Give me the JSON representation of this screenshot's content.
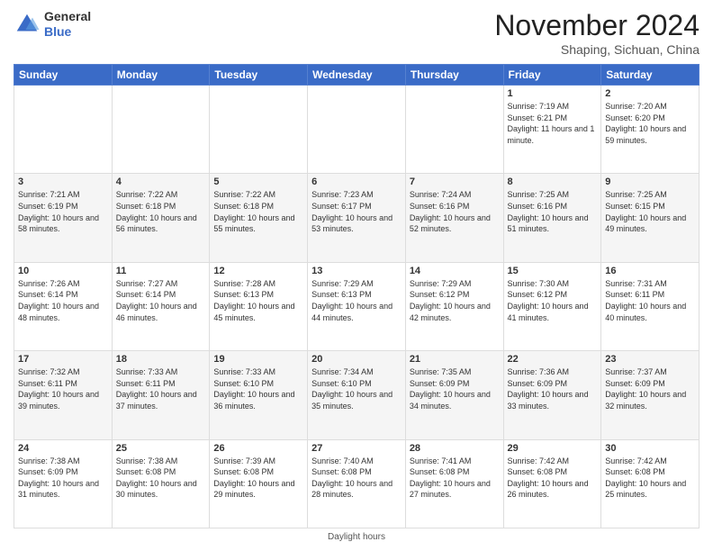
{
  "logo": {
    "line1": "General",
    "line2": "Blue"
  },
  "title": "November 2024",
  "location": "Shaping, Sichuan, China",
  "days_of_week": [
    "Sunday",
    "Monday",
    "Tuesday",
    "Wednesday",
    "Thursday",
    "Friday",
    "Saturday"
  ],
  "footer": "Daylight hours",
  "weeks": [
    [
      {
        "day": "",
        "info": ""
      },
      {
        "day": "",
        "info": ""
      },
      {
        "day": "",
        "info": ""
      },
      {
        "day": "",
        "info": ""
      },
      {
        "day": "",
        "info": ""
      },
      {
        "day": "1",
        "info": "Sunrise: 7:19 AM\nSunset: 6:21 PM\nDaylight: 11 hours and 1 minute."
      },
      {
        "day": "2",
        "info": "Sunrise: 7:20 AM\nSunset: 6:20 PM\nDaylight: 10 hours and 59 minutes."
      }
    ],
    [
      {
        "day": "3",
        "info": "Sunrise: 7:21 AM\nSunset: 6:19 PM\nDaylight: 10 hours and 58 minutes."
      },
      {
        "day": "4",
        "info": "Sunrise: 7:22 AM\nSunset: 6:18 PM\nDaylight: 10 hours and 56 minutes."
      },
      {
        "day": "5",
        "info": "Sunrise: 7:22 AM\nSunset: 6:18 PM\nDaylight: 10 hours and 55 minutes."
      },
      {
        "day": "6",
        "info": "Sunrise: 7:23 AM\nSunset: 6:17 PM\nDaylight: 10 hours and 53 minutes."
      },
      {
        "day": "7",
        "info": "Sunrise: 7:24 AM\nSunset: 6:16 PM\nDaylight: 10 hours and 52 minutes."
      },
      {
        "day": "8",
        "info": "Sunrise: 7:25 AM\nSunset: 6:16 PM\nDaylight: 10 hours and 51 minutes."
      },
      {
        "day": "9",
        "info": "Sunrise: 7:25 AM\nSunset: 6:15 PM\nDaylight: 10 hours and 49 minutes."
      }
    ],
    [
      {
        "day": "10",
        "info": "Sunrise: 7:26 AM\nSunset: 6:14 PM\nDaylight: 10 hours and 48 minutes."
      },
      {
        "day": "11",
        "info": "Sunrise: 7:27 AM\nSunset: 6:14 PM\nDaylight: 10 hours and 46 minutes."
      },
      {
        "day": "12",
        "info": "Sunrise: 7:28 AM\nSunset: 6:13 PM\nDaylight: 10 hours and 45 minutes."
      },
      {
        "day": "13",
        "info": "Sunrise: 7:29 AM\nSunset: 6:13 PM\nDaylight: 10 hours and 44 minutes."
      },
      {
        "day": "14",
        "info": "Sunrise: 7:29 AM\nSunset: 6:12 PM\nDaylight: 10 hours and 42 minutes."
      },
      {
        "day": "15",
        "info": "Sunrise: 7:30 AM\nSunset: 6:12 PM\nDaylight: 10 hours and 41 minutes."
      },
      {
        "day": "16",
        "info": "Sunrise: 7:31 AM\nSunset: 6:11 PM\nDaylight: 10 hours and 40 minutes."
      }
    ],
    [
      {
        "day": "17",
        "info": "Sunrise: 7:32 AM\nSunset: 6:11 PM\nDaylight: 10 hours and 39 minutes."
      },
      {
        "day": "18",
        "info": "Sunrise: 7:33 AM\nSunset: 6:11 PM\nDaylight: 10 hours and 37 minutes."
      },
      {
        "day": "19",
        "info": "Sunrise: 7:33 AM\nSunset: 6:10 PM\nDaylight: 10 hours and 36 minutes."
      },
      {
        "day": "20",
        "info": "Sunrise: 7:34 AM\nSunset: 6:10 PM\nDaylight: 10 hours and 35 minutes."
      },
      {
        "day": "21",
        "info": "Sunrise: 7:35 AM\nSunset: 6:09 PM\nDaylight: 10 hours and 34 minutes."
      },
      {
        "day": "22",
        "info": "Sunrise: 7:36 AM\nSunset: 6:09 PM\nDaylight: 10 hours and 33 minutes."
      },
      {
        "day": "23",
        "info": "Sunrise: 7:37 AM\nSunset: 6:09 PM\nDaylight: 10 hours and 32 minutes."
      }
    ],
    [
      {
        "day": "24",
        "info": "Sunrise: 7:38 AM\nSunset: 6:09 PM\nDaylight: 10 hours and 31 minutes."
      },
      {
        "day": "25",
        "info": "Sunrise: 7:38 AM\nSunset: 6:08 PM\nDaylight: 10 hours and 30 minutes."
      },
      {
        "day": "26",
        "info": "Sunrise: 7:39 AM\nSunset: 6:08 PM\nDaylight: 10 hours and 29 minutes."
      },
      {
        "day": "27",
        "info": "Sunrise: 7:40 AM\nSunset: 6:08 PM\nDaylight: 10 hours and 28 minutes."
      },
      {
        "day": "28",
        "info": "Sunrise: 7:41 AM\nSunset: 6:08 PM\nDaylight: 10 hours and 27 minutes."
      },
      {
        "day": "29",
        "info": "Sunrise: 7:42 AM\nSunset: 6:08 PM\nDaylight: 10 hours and 26 minutes."
      },
      {
        "day": "30",
        "info": "Sunrise: 7:42 AM\nSunset: 6:08 PM\nDaylight: 10 hours and 25 minutes."
      }
    ]
  ]
}
